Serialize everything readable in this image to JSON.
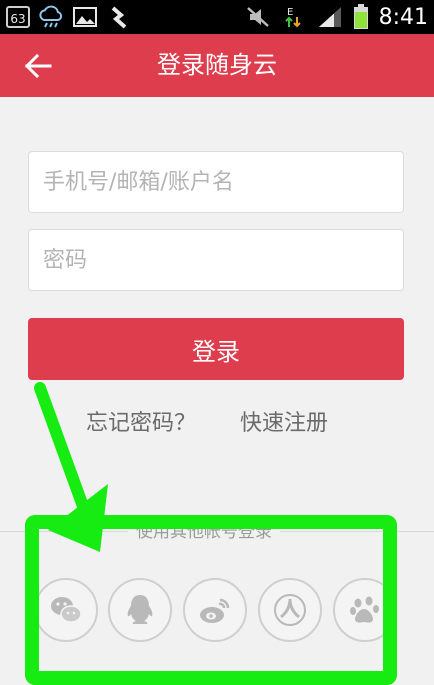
{
  "status_bar": {
    "badge": "63",
    "time": "8:41",
    "network_label": "E"
  },
  "header": {
    "title": "登录随身云"
  },
  "form": {
    "username_placeholder": "手机号/邮箱/账户名",
    "username_value": "",
    "password_placeholder": "密码",
    "password_value": "",
    "login_label": "登录"
  },
  "links": {
    "forgot_password": "忘记密码？",
    "quick_register": "快速注册"
  },
  "other_login": {
    "label": "使用其他帐号登录",
    "providers": [
      "wechat-icon",
      "qq-icon",
      "weibo-icon",
      "renren-icon",
      "baidu-icon"
    ]
  },
  "colors": {
    "brand": "#dd3d4c",
    "highlight": "#16ec12"
  }
}
